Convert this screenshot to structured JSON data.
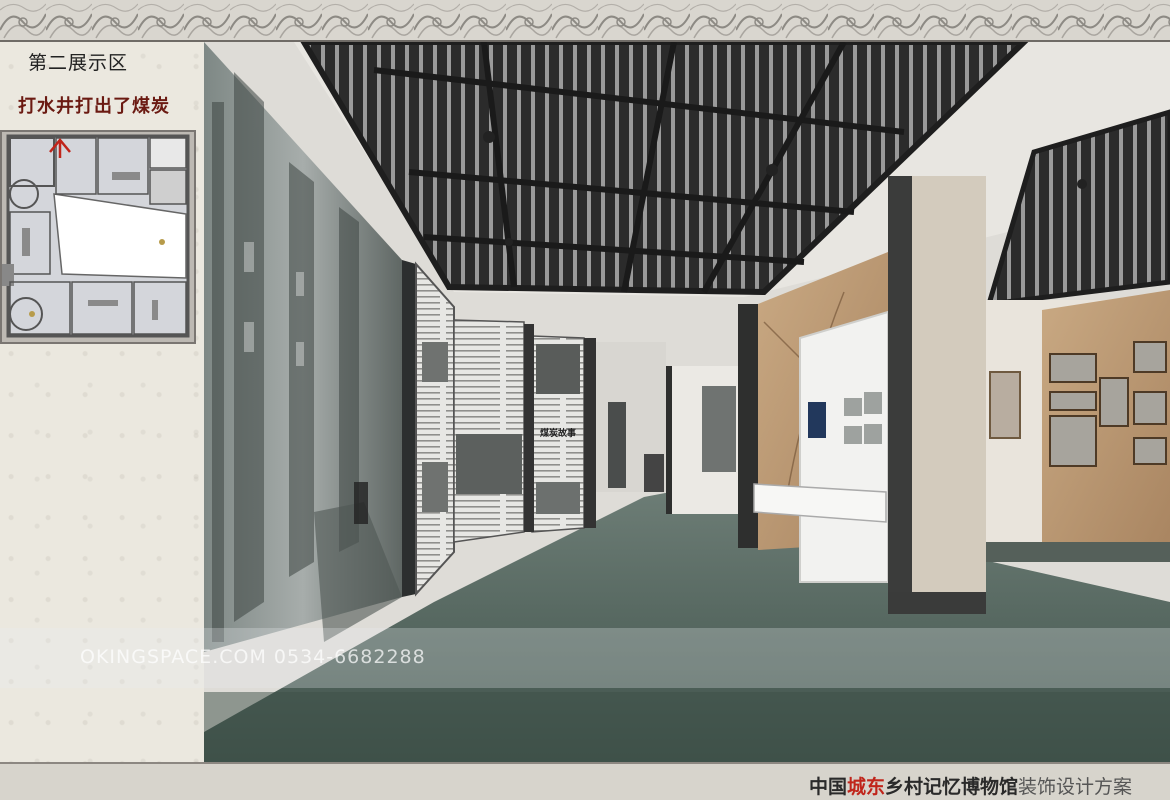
{
  "zone_title": "第二展示区",
  "exhibit_title": "打水井打出了煤炭",
  "watermark": "OKINGSPACE.COM 0534-6682288",
  "footer": {
    "part1": "中国",
    "part2": "城东",
    "part3": "乡村记忆博物馆",
    "part4": "装饰设计方案"
  },
  "panels": {
    "main_heading": "煤炭故事"
  },
  "colors": {
    "accent_red": "#c0251b",
    "title_dark_red": "#6b1a12",
    "floor_green": "#4c5f57",
    "ceiling_dark": "#2e2e2e"
  },
  "icons": {
    "location_marker": "red-arrow-icon"
  }
}
